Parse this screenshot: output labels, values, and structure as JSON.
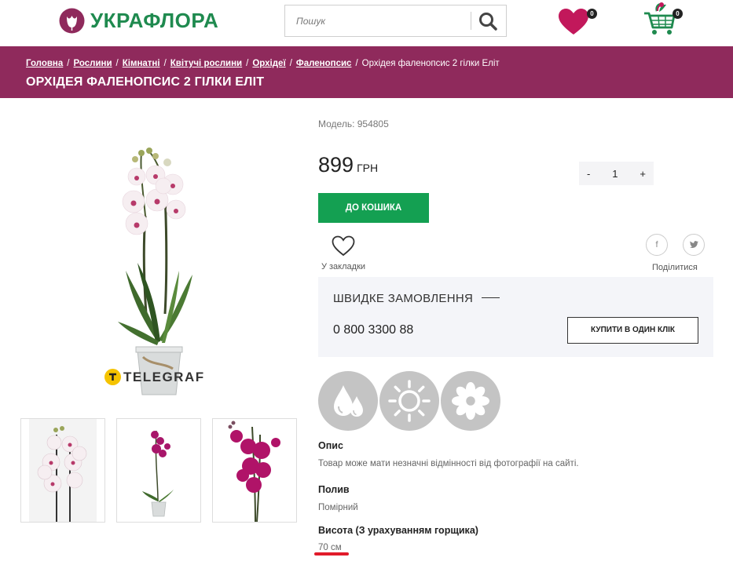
{
  "header": {
    "logo_text": "УКРАФЛОРА",
    "search_placeholder": "Пошук",
    "wishlist_count": "0",
    "cart_count": "0"
  },
  "breadcrumb": {
    "items": [
      "Головна",
      "Рослини",
      "Кімнатні",
      "Квітучі рослини",
      "Орхідеї",
      "Фаленопсис"
    ],
    "current": "Орхідея фаленопсис 2 гілки Еліт"
  },
  "page_title": "ОРХІДЕЯ ФАЛЕНОПСИС 2 ГІЛКИ ЕЛІТ",
  "product": {
    "watermark": "TELEGRAF",
    "model": "Модель: 954805",
    "price": "899",
    "currency": "ГРН",
    "quantity": "1",
    "qty_minus": "-",
    "qty_plus": "+",
    "add_to_cart": "ДО КОШИКА",
    "bookmark_label": "У закладки",
    "share_label": "Поділитися",
    "share_icons": [
      "f",
      "t"
    ]
  },
  "quick_order": {
    "title": "ШВИДКЕ ЗАМОВЛЕННЯ",
    "phone": "0 800 3300 88",
    "button": "КУПИТИ В ОДИН КЛІК"
  },
  "care_icons": [
    "water-drops-icon",
    "sun-icon",
    "flower-icon"
  ],
  "attributes": [
    {
      "name": "Опис",
      "value": "Товар може мати незначні відмінності від фотографії на сайті."
    },
    {
      "name": "Полив",
      "value": "Помірний"
    },
    {
      "name": "Висота (З урахуванням горщика)",
      "value": "70 см"
    }
  ],
  "colors": {
    "brand_purple": "#8f2a5c",
    "logo_green": "#1f8a4f",
    "buy_green": "#14a052",
    "heart": "#c2185b",
    "underline_red": "#e11b2a"
  }
}
